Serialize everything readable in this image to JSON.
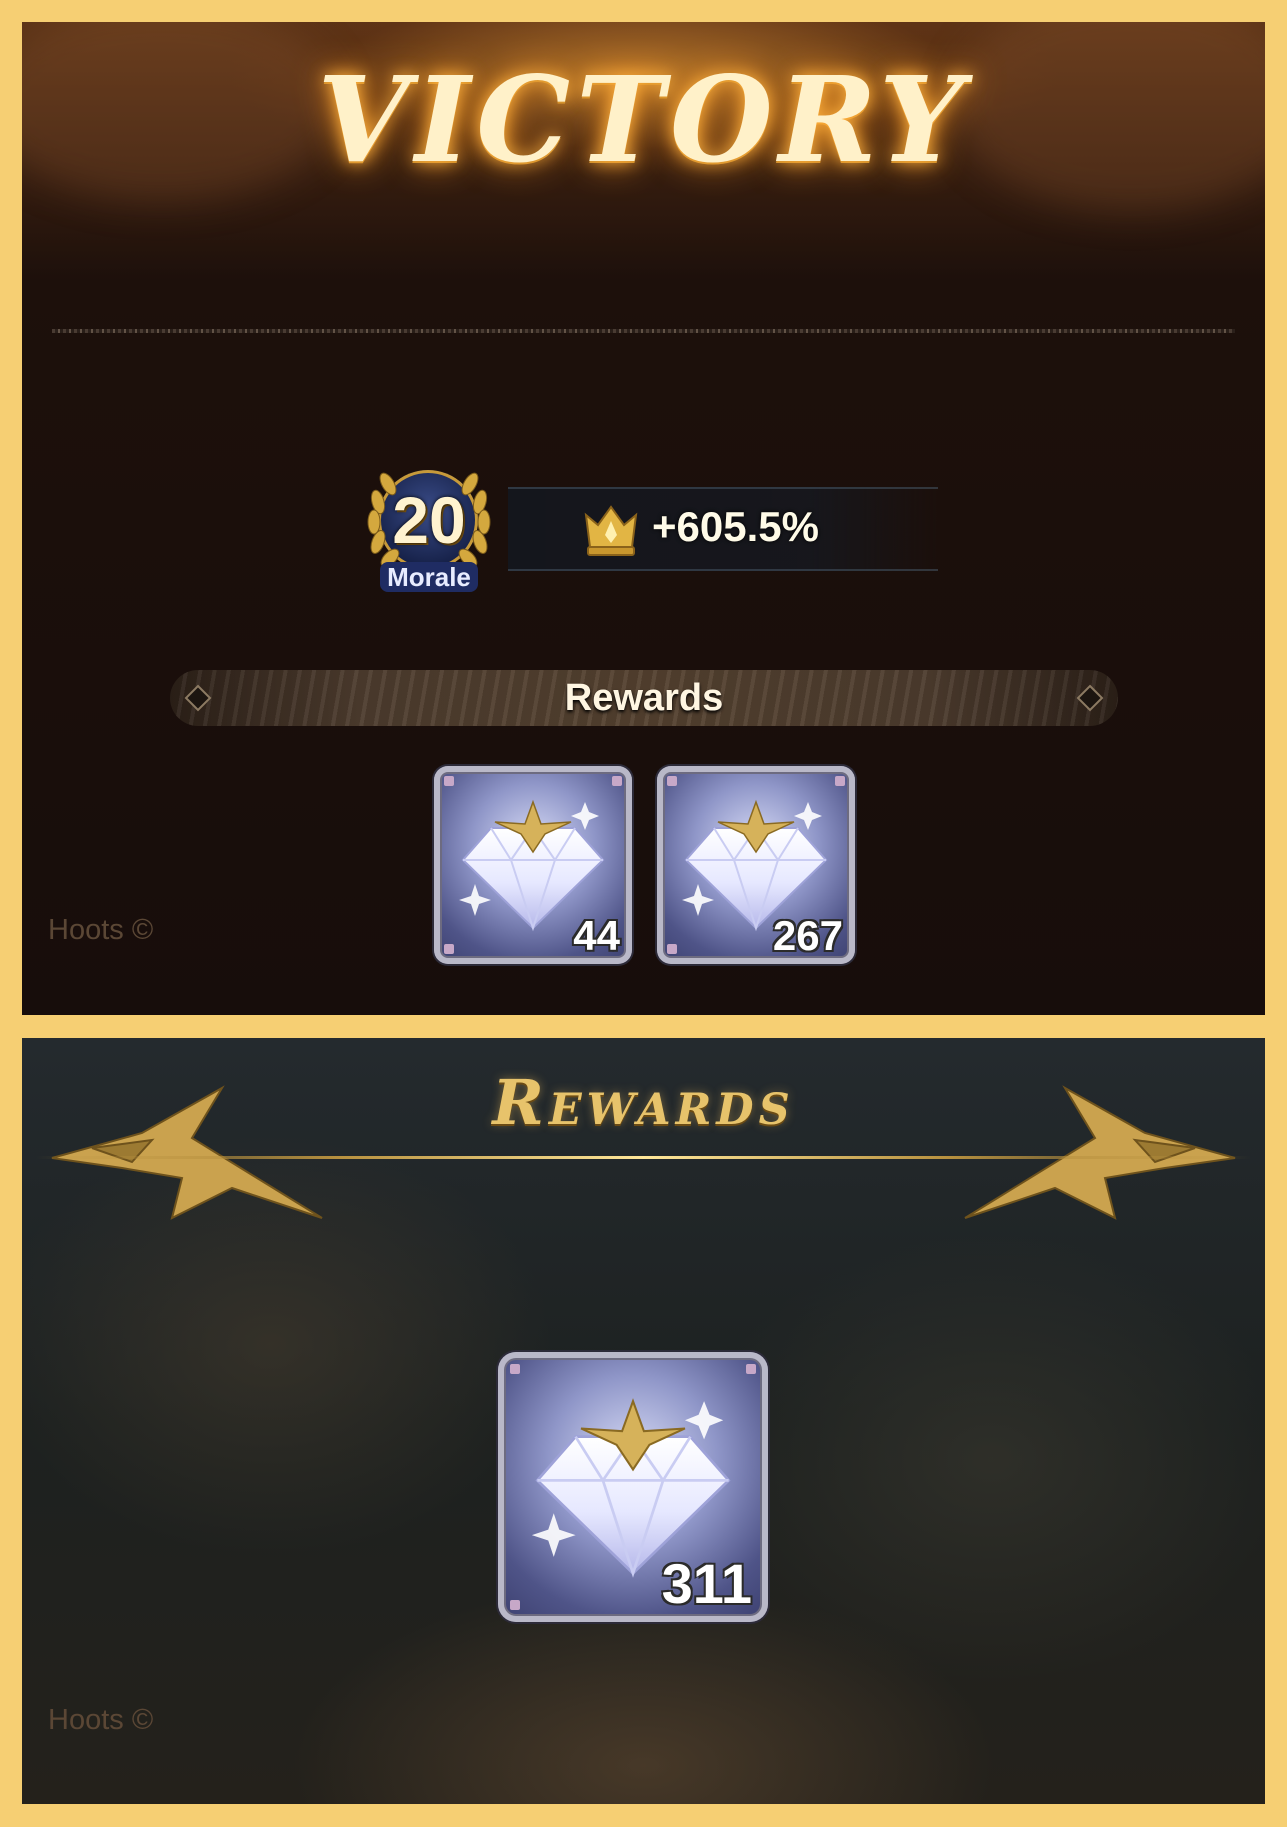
{
  "victory_screen": {
    "title": "VICTORY",
    "morale": {
      "level": "20",
      "label": "Morale"
    },
    "bonus": {
      "icon": "crown-icon",
      "value": "+605.5%"
    },
    "rewards_header": "Rewards",
    "rewards": [
      {
        "icon": "diamond-icon",
        "count": "44"
      },
      {
        "icon": "diamond-icon",
        "count": "267"
      }
    ],
    "watermark": "Hoots ©"
  },
  "rewards_screen": {
    "title": "Rewards",
    "rewards": [
      {
        "icon": "diamond-icon",
        "count": "311"
      }
    ],
    "watermark": "Hoots ©"
  },
  "colors": {
    "frame": "#f6cf73",
    "gold_text": "#e7c36b",
    "glow": "#ffb340"
  }
}
